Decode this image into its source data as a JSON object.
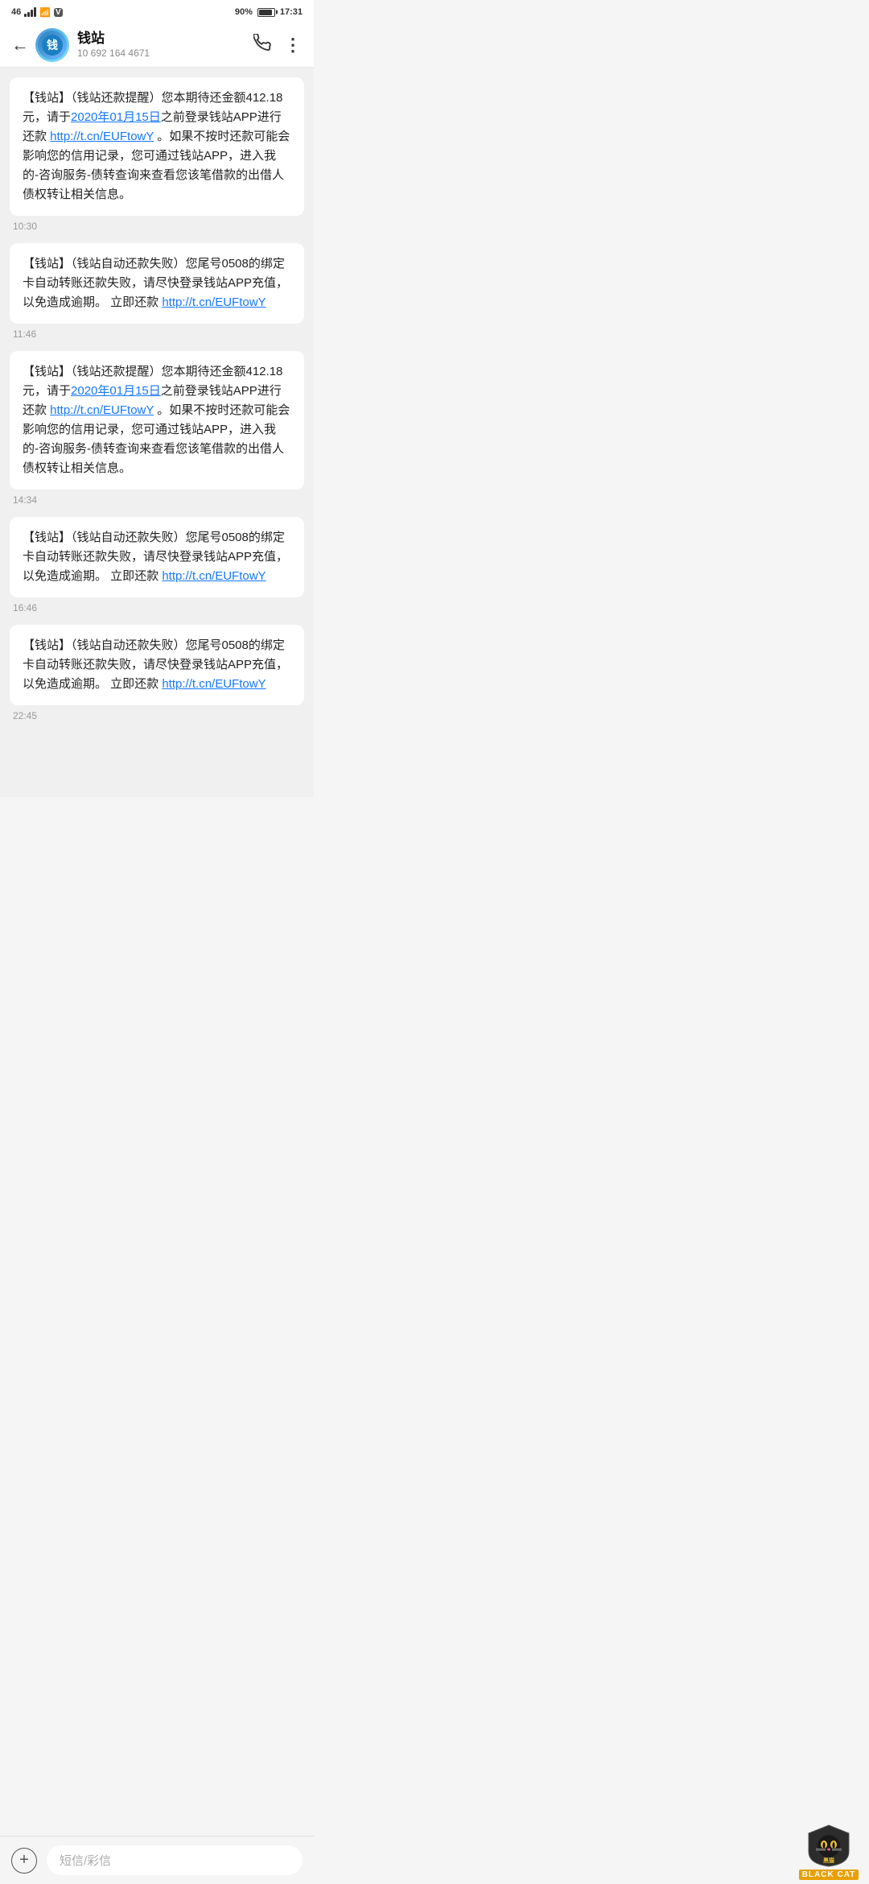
{
  "statusBar": {
    "signal": "46",
    "battery": "90%",
    "time": "17:31"
  },
  "header": {
    "backLabel": "←",
    "title": "钱站",
    "subtitle": "10 692 164 4671",
    "callIcon": "📞",
    "moreIcon": "⋮"
  },
  "messages": [
    {
      "id": "msg1",
      "text_parts": [
        {
          "type": "text",
          "content": "【钱站】（钱站还款提醒）您本期待还金额412.18元，请于"
        },
        {
          "type": "link",
          "content": "2020年01月15日"
        },
        {
          "type": "text",
          "content": "之前登录钱站APP进行还款 "
        },
        {
          "type": "link",
          "content": "http://t.cn/EUFtowY"
        },
        {
          "type": "text",
          "content": " 。如果不按时还款可能会影响您的信用记录，您可通过钱站APP，进入我的-咨询服务-债转查询来查看您该笔借款的出借人债权转让相关信息。"
        }
      ],
      "time": "10:30"
    },
    {
      "id": "msg2",
      "text_parts": [
        {
          "type": "text",
          "content": "【钱站】（钱站自动还款失败）您尾号0508的绑定卡自动转账还款失败，请尽快登录钱站APP充值，以免造成逾期。  立即还款 "
        },
        {
          "type": "link",
          "content": "http://t.cn/EUFtowY"
        }
      ],
      "time": "11:46"
    },
    {
      "id": "msg3",
      "text_parts": [
        {
          "type": "text",
          "content": "【钱站】（钱站还款提醒）您本期待还金额412.18元，请于"
        },
        {
          "type": "link",
          "content": "2020年01月15日"
        },
        {
          "type": "text",
          "content": "之前登录钱站APP进行还款 "
        },
        {
          "type": "link",
          "content": "http://t.cn/EUFtowY"
        },
        {
          "type": "text",
          "content": " 。如果不按时还款可能会影响您的信用记录，您可通过钱站APP，进入我的-咨询服务-债转查询来查看您该笔借款的出借人债权转让相关信息。"
        }
      ],
      "time": "14:34"
    },
    {
      "id": "msg4",
      "text_parts": [
        {
          "type": "text",
          "content": "【钱站】（钱站自动还款失败）您尾号0508的绑定卡自动转账还款失败，请尽快登录钱站APP充值，以免造成逾期。  立即还款 "
        },
        {
          "type": "link",
          "content": "http://t.cn/EUFtowY"
        }
      ],
      "time": "16:46"
    },
    {
      "id": "msg5",
      "text_parts": [
        {
          "type": "text",
          "content": "【钱站】（钱站自动还款失败）您尾号0508的绑定卡自动转账还款失败，请尽快登录钱站APP充值，以免造成逾期。  立即还款 "
        },
        {
          "type": "link",
          "content": "http://t.cn/EUFtowY"
        }
      ],
      "time": "22:45"
    }
  ],
  "bottomBar": {
    "addIcon": "+",
    "placeholder": "短信/彩信"
  },
  "watermark": {
    "text": "BLACK CAT"
  }
}
